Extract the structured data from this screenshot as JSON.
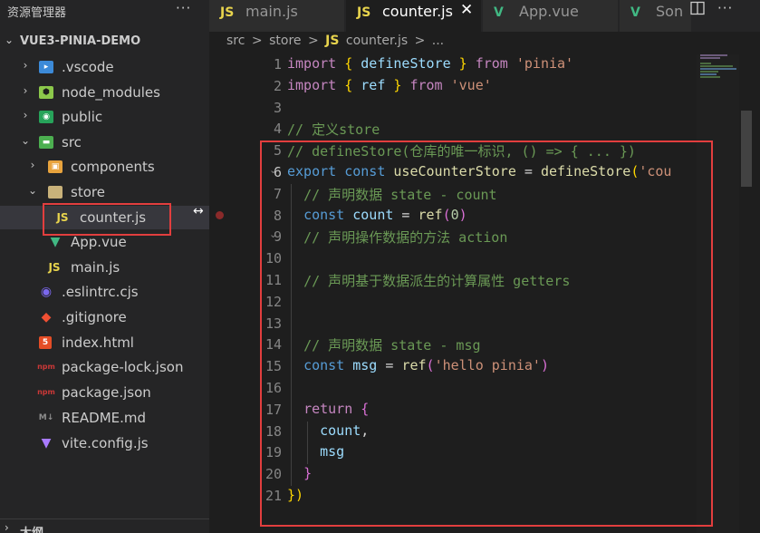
{
  "sidebar": {
    "title": "资源管理器",
    "more": "···",
    "project": "VUE3-PINIA-DEMO",
    "items": [
      {
        "label": ".vscode",
        "icon": "vscode-folder-icon",
        "color": "#3c8ad8"
      },
      {
        "label": "node_modules",
        "icon": "node-folder-icon",
        "color": "#8cc84b"
      },
      {
        "label": "public",
        "icon": "public-folder-icon",
        "color": "#27a35a"
      },
      {
        "label": "src",
        "icon": "src-folder-icon",
        "color": "#4caf50"
      },
      {
        "label": "components",
        "icon": "components-folder-icon",
        "color": "#e8a33d"
      },
      {
        "label": "store",
        "icon": "store-folder-icon",
        "color": "#c9b27a"
      },
      {
        "label": "counter.js",
        "icon": "js-file-icon",
        "color": "#e8d44d"
      },
      {
        "label": "App.vue",
        "icon": "vue-file-icon",
        "color": "#41b883"
      },
      {
        "label": "main.js",
        "icon": "js-file-icon",
        "color": "#e8d44d"
      },
      {
        "label": ".eslintrc.cjs",
        "icon": "eslint-icon",
        "color": "#7b68ee"
      },
      {
        "label": ".gitignore",
        "icon": "git-icon",
        "color": "#f05033"
      },
      {
        "label": "index.html",
        "icon": "html5-icon",
        "color": "#e44d26"
      },
      {
        "label": "package-lock.json",
        "icon": "npm-icon",
        "color": "#cb3837"
      },
      {
        "label": "package.json",
        "icon": "npm-icon",
        "color": "#cb3837"
      },
      {
        "label": "README.md",
        "icon": "markdown-icon",
        "color": "#8c8c8c"
      },
      {
        "label": "vite.config.js",
        "icon": "vite-icon",
        "color": "#a97bff"
      }
    ],
    "outline": "大纲"
  },
  "tabs": [
    {
      "label": "main.js",
      "icon_text": "JS"
    },
    {
      "label": "counter.js",
      "icon_text": "JS",
      "close": "✕"
    },
    {
      "label": "App.vue",
      "icon_text": "V"
    },
    {
      "label": "Son",
      "icon_text": "V"
    }
  ],
  "toolbar": {
    "more": "···"
  },
  "breadcrumb": {
    "parts": [
      "src",
      "store",
      "counter.js",
      "..."
    ],
    "js_label": "JS",
    "sep": ">"
  },
  "editor": {
    "line_numbers": [
      "1",
      "2",
      "3",
      "4",
      "5",
      "6",
      "7",
      "8",
      "9",
      "10",
      "11",
      "12",
      "13",
      "14",
      "15",
      "16",
      "17",
      "18",
      "19",
      "20",
      "21"
    ],
    "active_line": 6,
    "lines": [
      [
        [
          "kw",
          "import"
        ],
        [
          "op",
          " "
        ],
        [
          "br1",
          "{"
        ],
        [
          "op",
          " "
        ],
        [
          "id",
          "defineStore"
        ],
        [
          "op",
          " "
        ],
        [
          "br1",
          "}"
        ],
        [
          "op",
          " "
        ],
        [
          "kw",
          "from"
        ],
        [
          "op",
          " "
        ],
        [
          "str",
          "'pinia'"
        ]
      ],
      [
        [
          "kw",
          "import"
        ],
        [
          "op",
          " "
        ],
        [
          "br1",
          "{"
        ],
        [
          "op",
          " "
        ],
        [
          "id",
          "ref"
        ],
        [
          "op",
          " "
        ],
        [
          "br1",
          "}"
        ],
        [
          "op",
          " "
        ],
        [
          "kw",
          "from"
        ],
        [
          "op",
          " "
        ],
        [
          "str",
          "'vue'"
        ]
      ],
      [],
      [
        [
          "cm",
          "// 定义store"
        ]
      ],
      [
        [
          "cm",
          "// defineStore(仓库的唯一标识, () => { ... })"
        ]
      ],
      [
        [
          "kw2",
          "export"
        ],
        [
          "op",
          " "
        ],
        [
          "kw2",
          "const"
        ],
        [
          "op",
          " "
        ],
        [
          "fn",
          "useCounterStore"
        ],
        [
          "op",
          " = "
        ],
        [
          "fn",
          "defineStore"
        ],
        [
          "br1",
          "("
        ],
        [
          "str",
          "'cou"
        ]
      ],
      [
        [
          "op",
          "  "
        ],
        [
          "cm",
          "// 声明数据 state - count"
        ]
      ],
      [
        [
          "op",
          "  "
        ],
        [
          "kw2",
          "const"
        ],
        [
          "op",
          " "
        ],
        [
          "id",
          "count"
        ],
        [
          "op",
          " = "
        ],
        [
          "fn",
          "ref"
        ],
        [
          "br2",
          "("
        ],
        [
          "num",
          "0"
        ],
        [
          "br2",
          ")"
        ]
      ],
      [
        [
          "op",
          "  "
        ],
        [
          "cm",
          "// 声明操作数据的方法 action"
        ]
      ],
      [],
      [
        [
          "op",
          "  "
        ],
        [
          "cm",
          "// 声明基于数据派生的计算属性 getters"
        ]
      ],
      [],
      [],
      [
        [
          "op",
          "  "
        ],
        [
          "cm",
          "// 声明数据 state - msg"
        ]
      ],
      [
        [
          "op",
          "  "
        ],
        [
          "kw2",
          "const"
        ],
        [
          "op",
          " "
        ],
        [
          "id",
          "msg"
        ],
        [
          "op",
          " = "
        ],
        [
          "fn",
          "ref"
        ],
        [
          "br2",
          "("
        ],
        [
          "str",
          "'hello pinia'"
        ],
        [
          "br2",
          ")"
        ]
      ],
      [],
      [
        [
          "op",
          "  "
        ],
        [
          "kw",
          "return"
        ],
        [
          "op",
          " "
        ],
        [
          "br2",
          "{"
        ]
      ],
      [
        [
          "op",
          "    "
        ],
        [
          "id",
          "count"
        ],
        [
          "op",
          ","
        ]
      ],
      [
        [
          "op",
          "    "
        ],
        [
          "id",
          "msg"
        ]
      ],
      [
        [
          "op",
          "  "
        ],
        [
          "br2",
          "}"
        ]
      ],
      [
        [
          "br1",
          "})"
        ]
      ]
    ]
  }
}
